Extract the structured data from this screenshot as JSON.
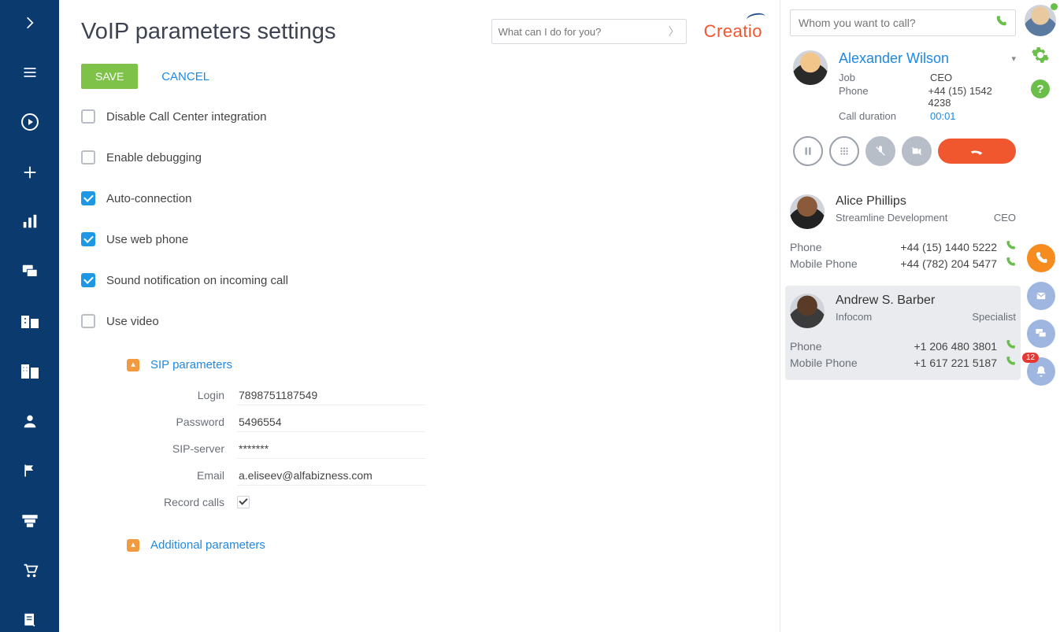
{
  "header": {
    "title": "VoIP parameters settings",
    "search_placeholder": "What can I do for you?",
    "brand": "Creatio"
  },
  "actions": {
    "save": "SAVE",
    "cancel": "CANCEL"
  },
  "options": [
    {
      "label": "Disable Call Center integration",
      "checked": false
    },
    {
      "label": "Enable debugging",
      "checked": false
    },
    {
      "label": "Auto-connection",
      "checked": true
    },
    {
      "label": "Use web phone",
      "checked": true
    },
    {
      "label": "Sound notification on incoming call",
      "checked": true
    },
    {
      "label": "Use video",
      "checked": false
    }
  ],
  "sip": {
    "section_title": "SIP parameters",
    "login_label": "Login",
    "login_value": "7898751187549",
    "password_label": "Password",
    "password_value": "5496554",
    "server_label": "SIP-server",
    "server_value": "*******",
    "email_label": "Email",
    "email_value": "a.eliseev@alfabizness.com",
    "record_label": "Record calls",
    "record_checked": true
  },
  "additional": {
    "section_title": "Additional parameters"
  },
  "cti": {
    "search_placeholder": "Whom you want to call?",
    "active": {
      "name": "Alexander Wilson",
      "job_label": "Job",
      "job_value": "CEO",
      "phone_label": "Phone",
      "phone_value": "+44 (15) 1542 4238",
      "duration_label": "Call duration",
      "duration_value": "00:01"
    },
    "contacts": [
      {
        "name": "Alice Phillips",
        "company": "Streamline Development",
        "role": "CEO",
        "phones": [
          {
            "label": "Phone",
            "number": "+44 (15) 1440 5222"
          },
          {
            "label": "Mobile Phone",
            "number": "+44 (782) 204 5477"
          }
        ]
      },
      {
        "name": "Andrew S. Barber",
        "company": "Infocom",
        "role": "Specialist",
        "phones": [
          {
            "label": "Phone",
            "number": "+1 206 480 3801"
          },
          {
            "label": "Mobile Phone",
            "number": "+1 617 221 5187"
          }
        ]
      }
    ]
  },
  "notifications_badge": "12"
}
